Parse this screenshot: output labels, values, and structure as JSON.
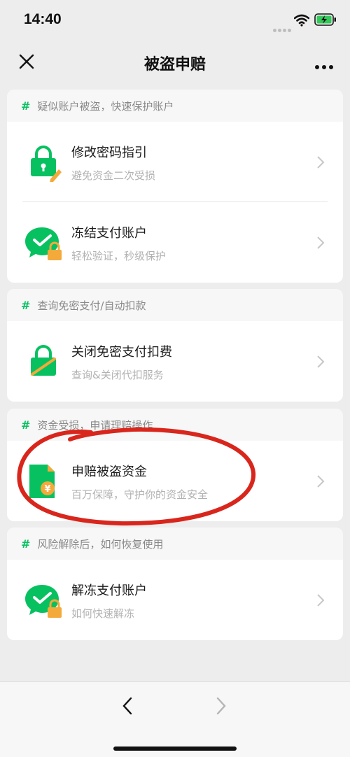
{
  "status": {
    "time": "14:40"
  },
  "nav": {
    "title": "被盗申赔"
  },
  "sections": [
    {
      "header": "疑似账户被盗，快速保护账户",
      "items": [
        {
          "title": "修改密码指引",
          "subtitle": "避免资金二次受损",
          "icon": "lock-edit-icon"
        },
        {
          "title": "冻结支付账户",
          "subtitle": "轻松验证，秒级保护",
          "icon": "wechat-pay-lock-icon"
        }
      ]
    },
    {
      "header": "查询免密支付/自动扣款",
      "items": [
        {
          "title": "关闭免密支付扣费",
          "subtitle": "查询&关闭代扣服务",
          "icon": "lock-slash-icon"
        }
      ]
    },
    {
      "header": "资金受损，申请理赔操作",
      "items": [
        {
          "title": "申赔被盗资金",
          "subtitle": "百万保障，守护你的资金安全",
          "icon": "claim-document-icon"
        }
      ]
    },
    {
      "header": "风险解除后，如何恢复使用",
      "items": [
        {
          "title": "解冻支付账户",
          "subtitle": "如何快速解冻",
          "icon": "wechat-pay-lock-icon"
        }
      ]
    }
  ],
  "colors": {
    "accent": "#07c160",
    "lock": "#f4a93b",
    "annotation": "#d9261c"
  }
}
